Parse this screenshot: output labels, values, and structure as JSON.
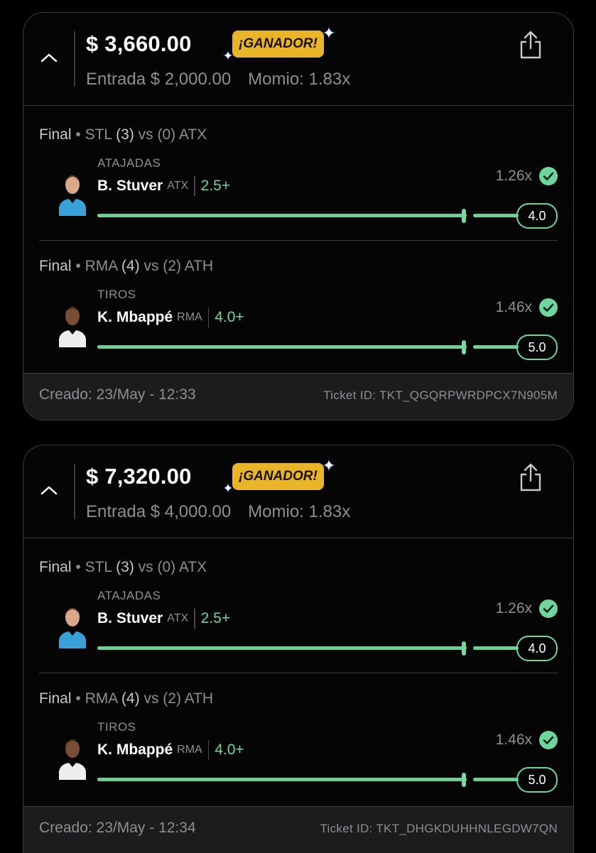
{
  "colors": {
    "accent_green": "#6fd59d",
    "badge_gold": "#e9b528",
    "muted_text": "#8e8e93",
    "border": "#3a3a3c"
  },
  "icons": {
    "collapse": "chevron-up-icon",
    "share": "share-icon",
    "status": "checkmark-circle-icon",
    "sparkle": "sparkle-icon"
  },
  "tickets": [
    {
      "payout": "$ 3,660.00",
      "badge": "¡GANADOR!",
      "entry": "Entrada $ 2,000.00",
      "odds": "Momio: 1.83x",
      "legs": [
        {
          "state": "Final",
          "home": "STL",
          "home_score": "(3)",
          "vs": "vs",
          "away_score": "(0)",
          "away": "ATX",
          "market": "ATAJADAS",
          "player": "B. Stuver",
          "team": "ATX",
          "target": "2.5+",
          "multiplier": "1.26x",
          "result": "4.0",
          "progress": 1.0
        },
        {
          "state": "Final",
          "home": "RMA",
          "home_score": "(4)",
          "vs": "vs",
          "away_score": "(2)",
          "away": "ATH",
          "market": "TIROS",
          "player": "K. Mbappé",
          "team": "RMA",
          "target": "4.0+",
          "multiplier": "1.46x",
          "result": "5.0",
          "progress": 1.0
        }
      ],
      "created": "Creado: 23/May - 12:33",
      "ticket_id": "Ticket ID: TKT_QGQRPWRDPCX7N905M"
    },
    {
      "payout": "$ 7,320.00",
      "badge": "¡GANADOR!",
      "entry": "Entrada $ 4,000.00",
      "odds": "Momio: 1.83x",
      "legs": [
        {
          "state": "Final",
          "home": "STL",
          "home_score": "(3)",
          "vs": "vs",
          "away_score": "(0)",
          "away": "ATX",
          "market": "ATAJADAS",
          "player": "B. Stuver",
          "team": "ATX",
          "target": "2.5+",
          "multiplier": "1.26x",
          "result": "4.0",
          "progress": 1.0
        },
        {
          "state": "Final",
          "home": "RMA",
          "home_score": "(4)",
          "vs": "vs",
          "away_score": "(2)",
          "away": "ATH",
          "market": "TIROS",
          "player": "K. Mbappé",
          "team": "RMA",
          "target": "4.0+",
          "multiplier": "1.46x",
          "result": "5.0",
          "progress": 1.0
        }
      ],
      "created": "Creado: 23/May - 12:34",
      "ticket_id": "Ticket ID: TKT_DHGKDUHHNLEGDW7QN"
    }
  ]
}
